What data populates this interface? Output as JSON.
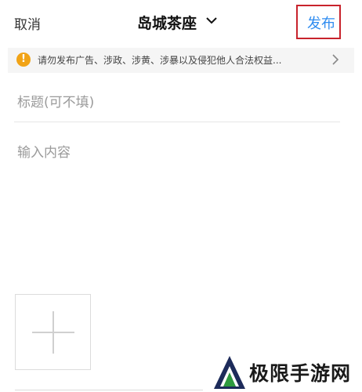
{
  "header": {
    "cancel_label": "取消",
    "title": "岛城茶座",
    "publish_label": "发布"
  },
  "notice": {
    "text": "请勿发布广告、涉政、涉黄、涉暴以及侵犯他人合法权益..."
  },
  "form": {
    "subject_placeholder": "标题(可不填)",
    "content_placeholder": "输入内容"
  },
  "colors": {
    "accent": "#2f8cf0",
    "highlight_frame": "#c8232c",
    "warning": "#f1a316"
  },
  "watermark": {
    "text": "极限手游网"
  }
}
